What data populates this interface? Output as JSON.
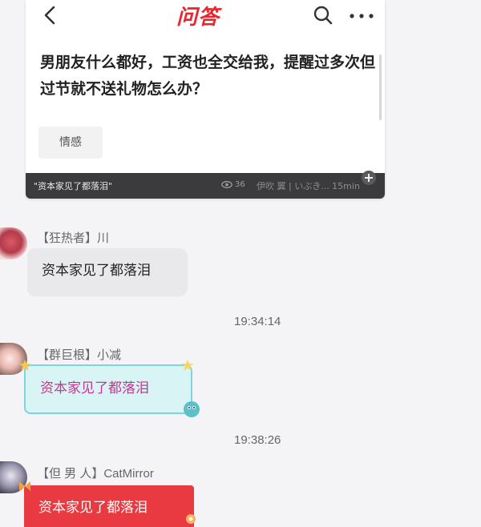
{
  "post": {
    "logo": "问答",
    "question": "男朋友什么都好，工资也全交给我，提醒过多次但过节就不送礼物怎么办？",
    "tag": "情感",
    "quote": "\"资本家见了都落泪\"",
    "views": "36",
    "author": "伊吹 翼 | いぶき... 15min"
  },
  "messages": [
    {
      "title": "【狂热者】",
      "name": "川",
      "text": "资本家见了都落泪"
    },
    {
      "time": "19:34:14"
    },
    {
      "title": "【群巨根】",
      "name": "小减",
      "text": "资本家见了都落泪"
    },
    {
      "time": "19:38:26"
    },
    {
      "title": "【但 男 人】",
      "name": "CatMirror",
      "text": "资本家见了都落泪"
    }
  ],
  "colors": {
    "brand_red": "#e8262e",
    "bubble_gray": "#e9e9ec",
    "bubble_cyan": "#d8f4f4",
    "bubble_pink_text": "#c5368f",
    "bubble_red": "#e83a40"
  }
}
